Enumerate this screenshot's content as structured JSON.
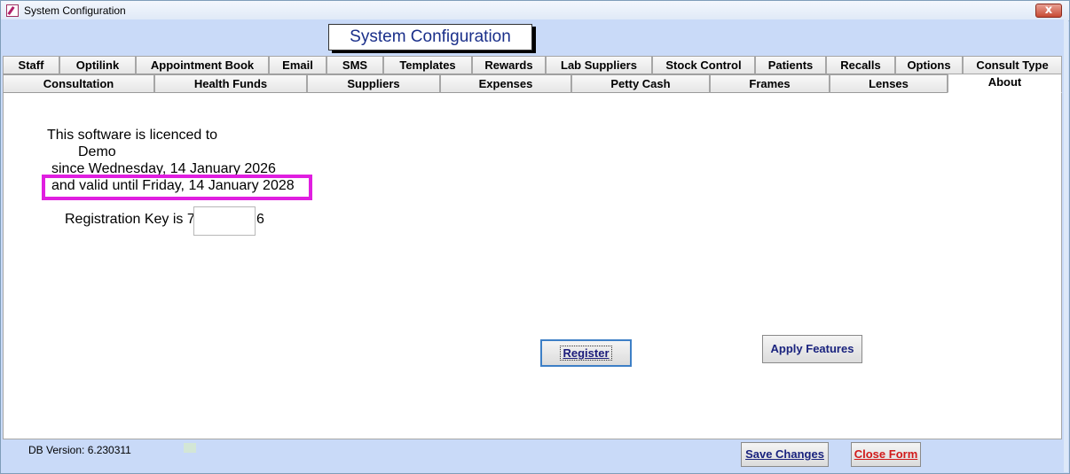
{
  "window": {
    "title": "System Configuration",
    "close_glyph": "x",
    "header_title": "System Configuration"
  },
  "tabs": {
    "row1": [
      "Staff",
      "Optilink",
      "Appointment Book",
      "Email",
      "SMS",
      "Templates",
      "Rewards",
      "Lab Suppliers",
      "Stock Control",
      "Patients",
      "Recalls",
      "Options",
      "Consult Type"
    ],
    "row2": [
      "Consultation",
      "Health Funds",
      "Suppliers",
      "Expenses",
      "Petty Cash",
      "Frames",
      "Lenses",
      "About"
    ],
    "active": "About"
  },
  "about": {
    "licenced_to_label": "This software is licenced to",
    "licensee": "Demo",
    "since": "since  Wednesday, 14 January 2026",
    "valid_until": "and valid until Friday, 14 January 2028",
    "reg_key_prefix": "Registration Key is 7",
    "reg_key_suffix": "6",
    "reg_key_value": ""
  },
  "buttons": {
    "register": "Register",
    "apply_features": "Apply Features",
    "save_changes": "Save Changes",
    "close_form": "Close Form"
  },
  "footer": {
    "db_version": "DB Version:  6.230311"
  },
  "colors": {
    "background": "#c9daf8",
    "highlight": "#e01ee0",
    "title_text": "#1a2f8a",
    "close_form_text": "#d11a1a"
  }
}
